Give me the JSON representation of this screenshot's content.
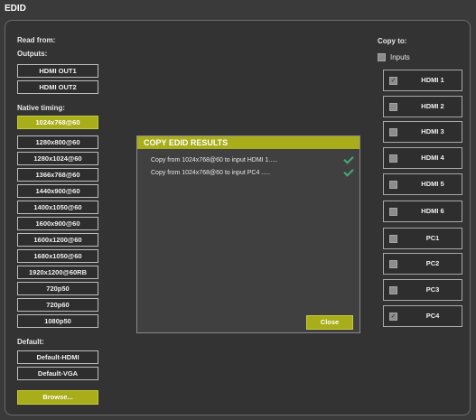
{
  "window": {
    "title": "EDID"
  },
  "read_from": {
    "label": "Read from:",
    "outputs_label": "Outputs:",
    "outputs": [
      "HDMI OUT1",
      "HDMI OUT2"
    ],
    "native_label": "Native timing:",
    "native": [
      "1024x768@60",
      "1280x800@60",
      "1280x1024@60",
      "1366x768@60",
      "1440x900@60",
      "1400x1050@60",
      "1600x900@60",
      "1600x1200@60",
      "1680x1050@60",
      "1920x1200@60RB",
      "720p50",
      "720p60",
      "1080p50"
    ],
    "selected": "1024x768@60",
    "default_label": "Default:",
    "defaults": [
      "Default-HDMI",
      "Default-VGA"
    ],
    "browse_label": "Browse..."
  },
  "copy_to": {
    "label": "Copy to:",
    "inputs_label": "Inputs",
    "inputs_checked": false,
    "targets": [
      {
        "label": "HDMI 1",
        "checked": true
      },
      {
        "label": "HDMI 2",
        "checked": false
      },
      {
        "label": "HDMI 3",
        "checked": false
      },
      {
        "label": "HDMI 4",
        "checked": false
      },
      {
        "label": "HDMI 5",
        "checked": false
      },
      {
        "label": "HDMI 6",
        "checked": false
      },
      {
        "label": "PC1",
        "checked": false
      },
      {
        "label": "PC2",
        "checked": false
      },
      {
        "label": "PC3",
        "checked": false
      },
      {
        "label": "PC4",
        "checked": true
      }
    ]
  },
  "dialog": {
    "title": "COPY EDID RESULTS",
    "results": [
      "Copy from 1024x768@60 to input HDMI 1.....",
      "Copy from 1024x768@60 to input PC4 ....."
    ],
    "close_label": "Close"
  },
  "colors": {
    "accent": "#a8ad19",
    "success": "#4aa87f",
    "background": "#333333"
  }
}
